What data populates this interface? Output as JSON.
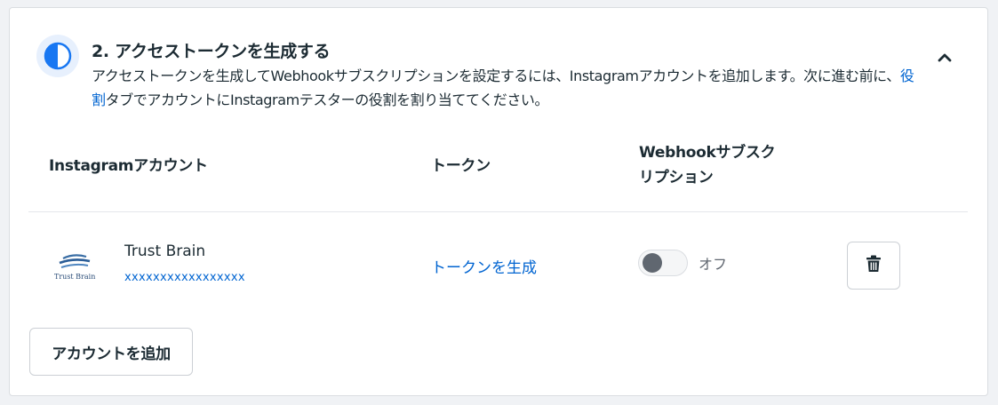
{
  "section": {
    "title": "2. アクセストークンを生成する",
    "desc_part1": "アクセストークンを生成してWebhookサブスクリプションを設定するには、Instagramアカウントを追加します。次に進む前に、",
    "desc_link": "役割",
    "desc_part2": "タブでアカウントにInstagramテスターの役割を割り当ててください。",
    "step_icon": "half-circle-icon",
    "collapse_icon": "chevron-up-icon"
  },
  "table": {
    "headers": {
      "account": "Instagramアカウント",
      "token": "トークン",
      "webhook": "Webhookサブスク\nリプション"
    },
    "rows": [
      {
        "name": "Trust Brain",
        "id": "xxxxxxxxxxxxxxxxx",
        "logo_text": "Trust Brain",
        "token_action": "トークンを生成",
        "toggle_state": "off",
        "toggle_label": "オフ",
        "delete_icon": "trash-icon"
      }
    ]
  },
  "buttons": {
    "add_account": "アカウントを追加"
  },
  "colors": {
    "link": "#0064d1",
    "accent": "#1877f2",
    "text": "#1c2b33",
    "muted": "#606770"
  }
}
